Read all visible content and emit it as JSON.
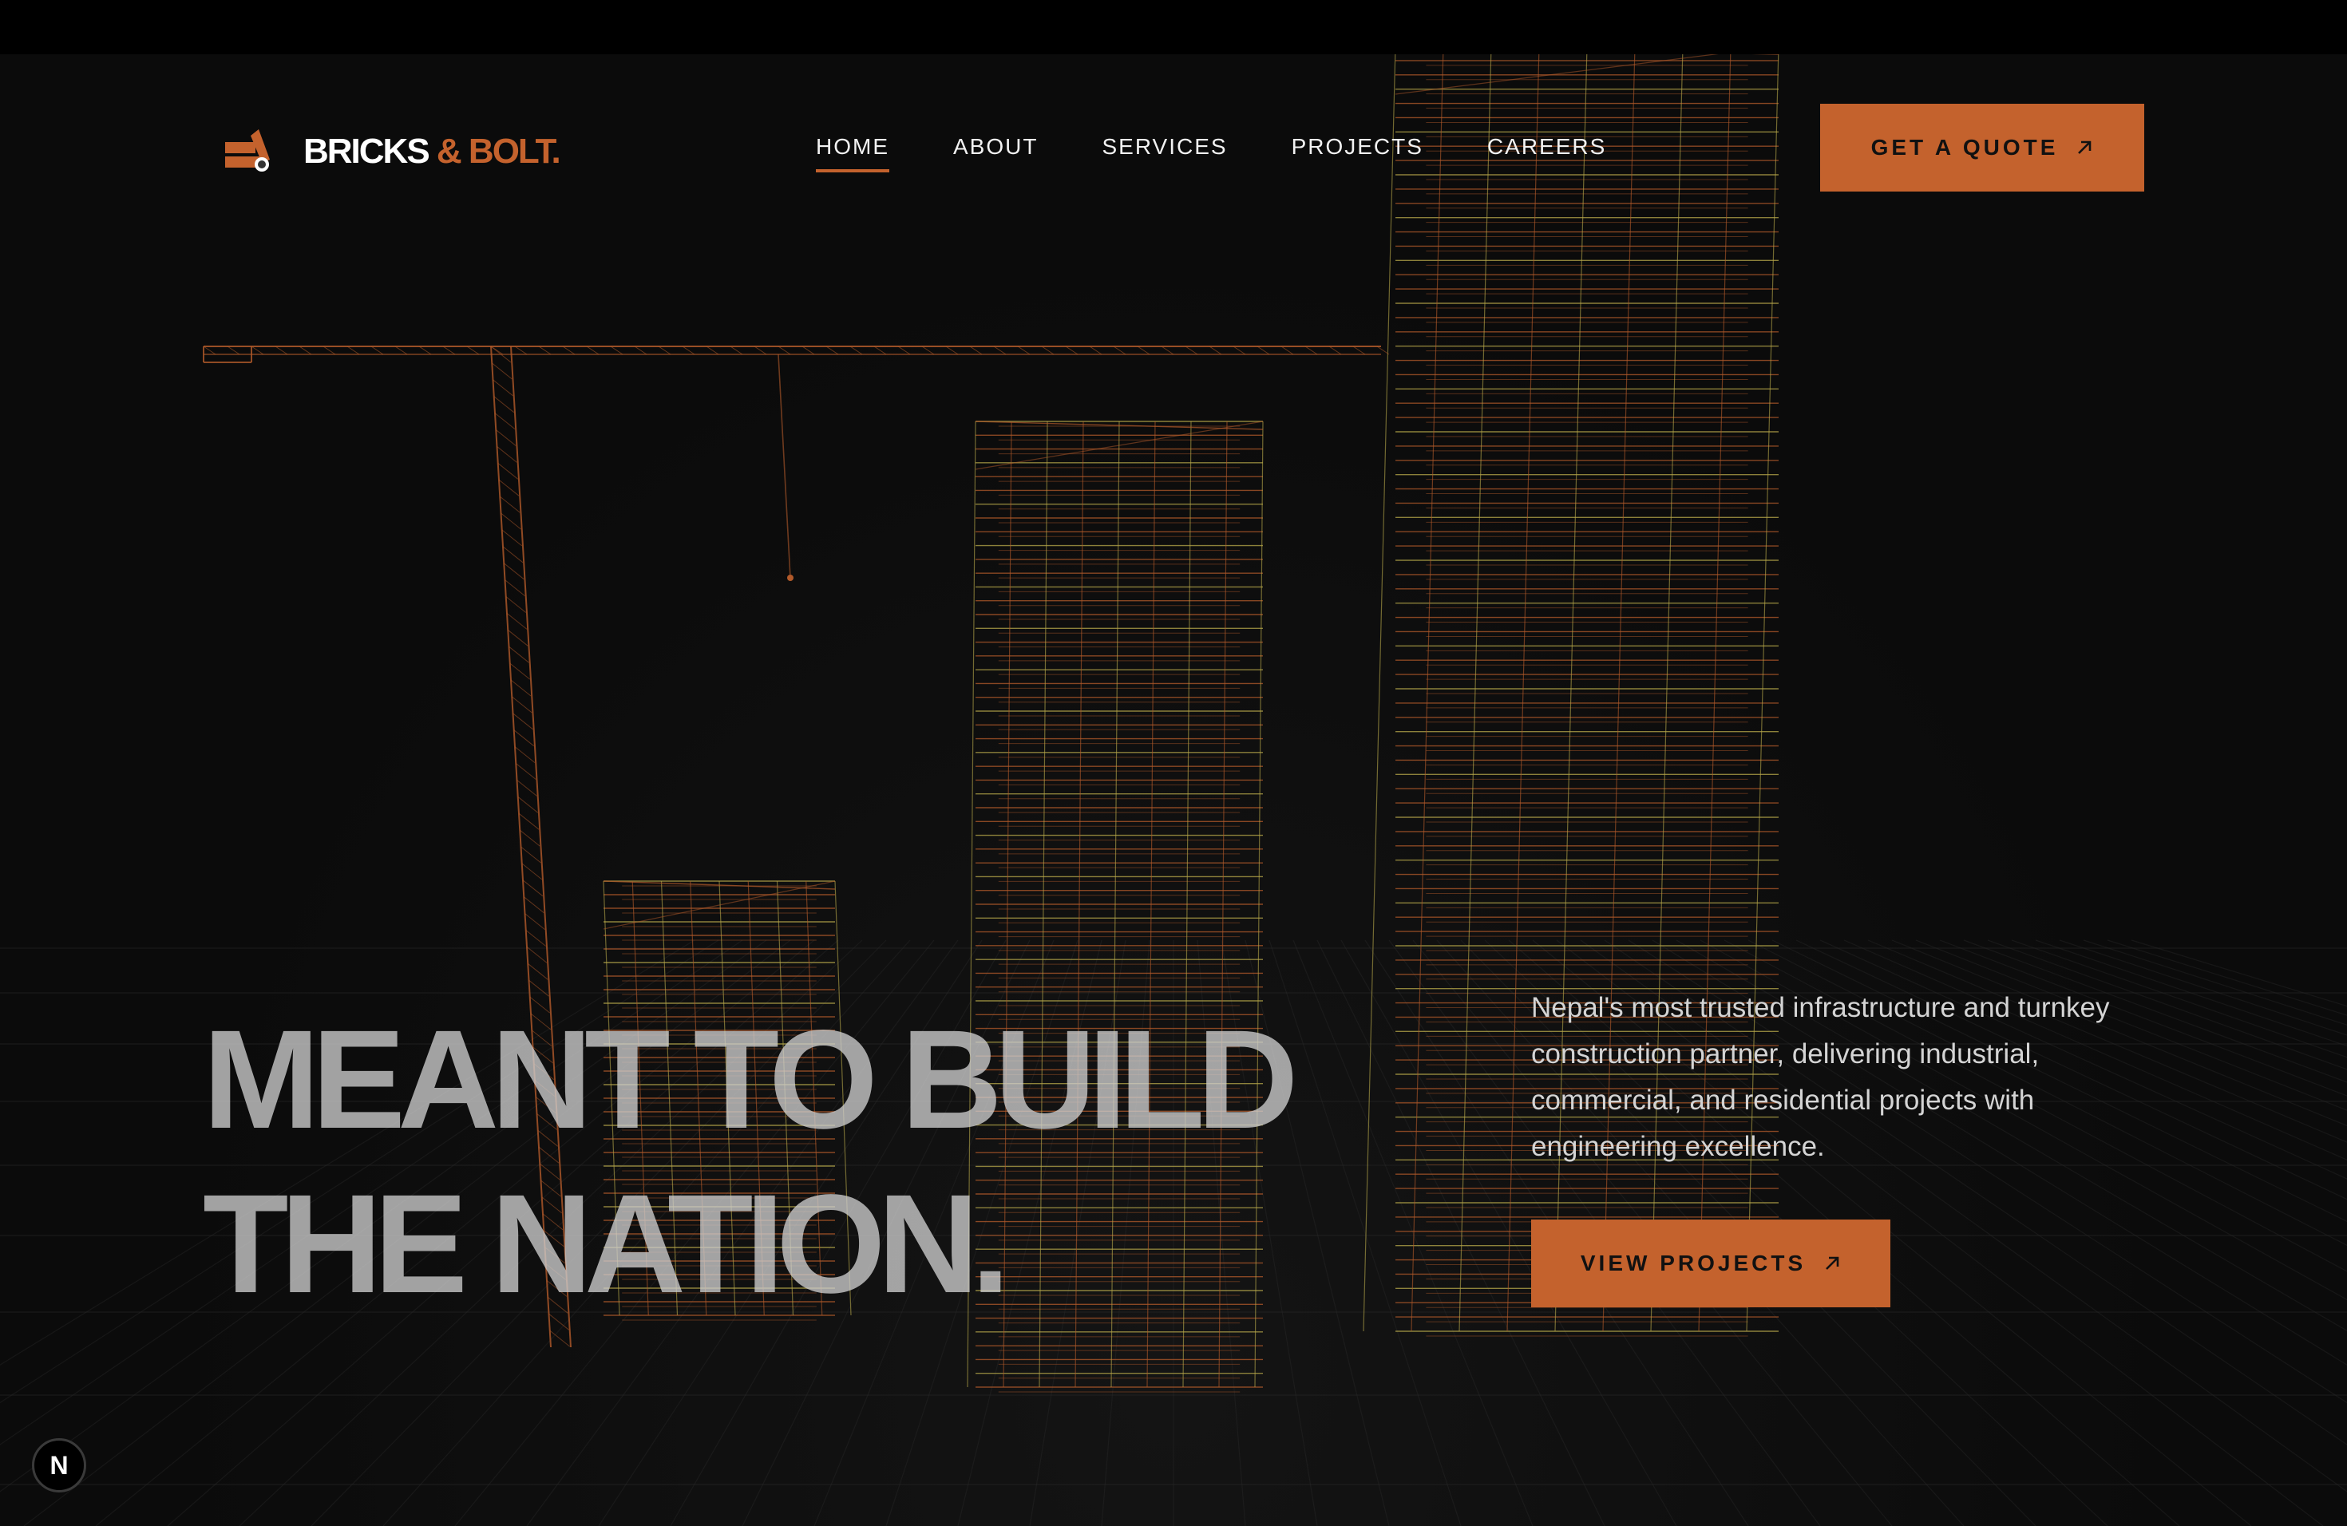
{
  "brand": {
    "name_main": "BRICKS",
    "name_accent": "& BOLT.",
    "accent_color": "#c4622d"
  },
  "nav": {
    "items": [
      {
        "label": "HOME",
        "active": true
      },
      {
        "label": "ABOUT",
        "active": false
      },
      {
        "label": "SERVICES",
        "active": false
      },
      {
        "label": "PROJECTS",
        "active": false
      },
      {
        "label": "CAREERS",
        "active": false
      }
    ]
  },
  "header": {
    "cta_label": "GET A QUOTE",
    "cta_icon": "arrow-up-right-icon"
  },
  "hero": {
    "headline_line1": "MEANT TO BUILD",
    "headline_line2": "THE NATION.",
    "description": "Nepal's most trusted infrastructure and turnkey construction partner, delivering industrial, commercial, and residential projects with engineering excellence.",
    "cta_label": "VIEW PROJECTS",
    "cta_icon": "arrow-up-right-icon"
  },
  "badge": {
    "label": "N"
  },
  "colors": {
    "background": "#0b0b0b",
    "accent": "#c4622d",
    "wire_orange": "#b25a2a",
    "wire_yellow": "#b7a84a"
  }
}
